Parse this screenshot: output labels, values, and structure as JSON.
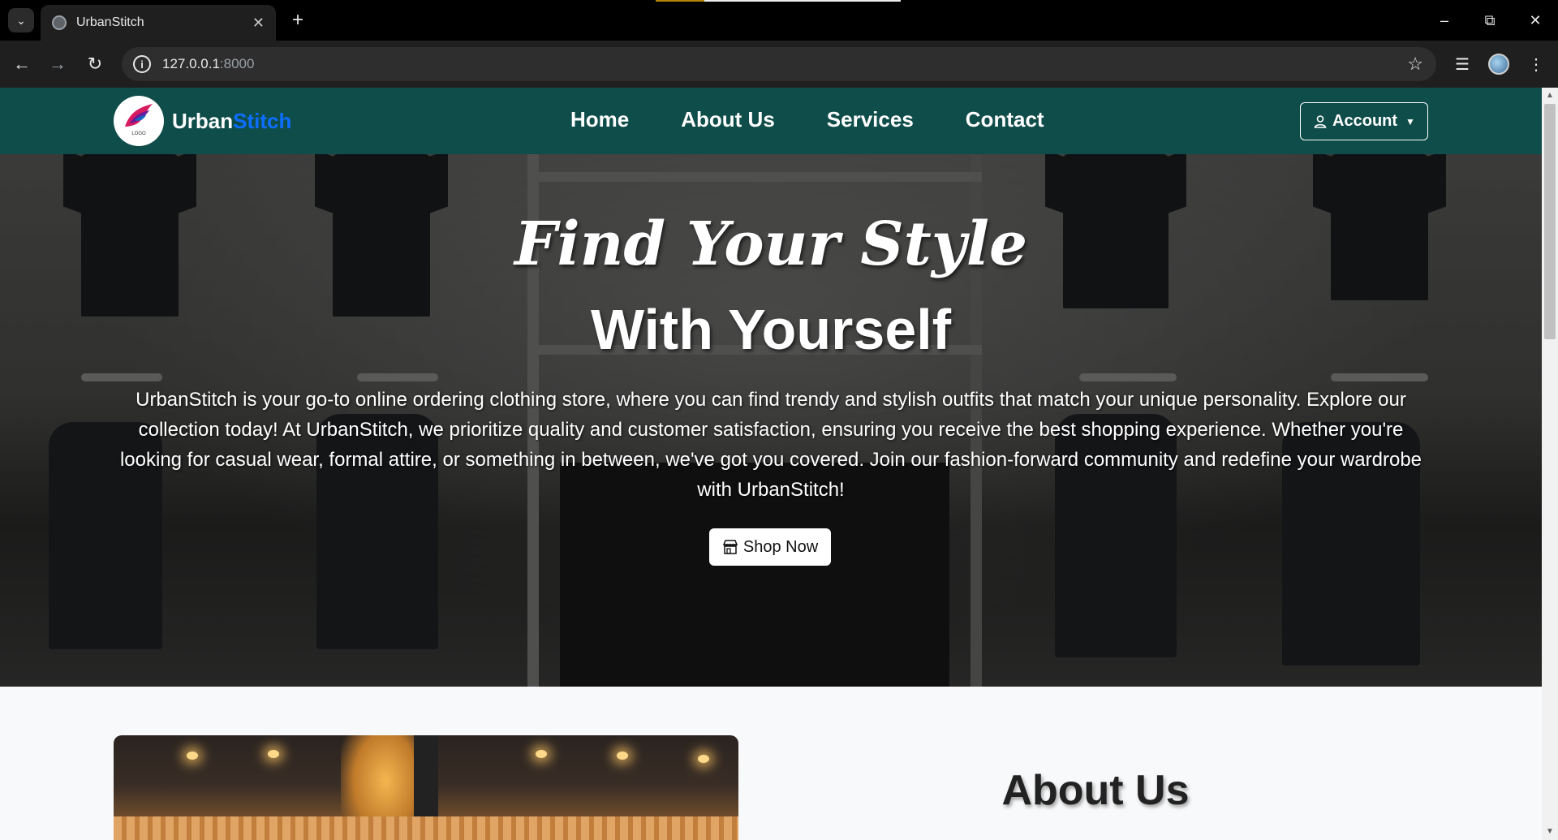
{
  "browser": {
    "tab_title": "UrbanStitch",
    "url_host": "127.0.0.1",
    "url_port": ":8000"
  },
  "navbar": {
    "brand_main": "Urban",
    "brand_accent": "Stitch",
    "logo_text": "LOGO",
    "menu": [
      "Home",
      "About Us",
      "Services",
      "Contact"
    ],
    "account_label": "Account"
  },
  "hero": {
    "title_line1": "Find Your Style",
    "title_line2": "With Yourself",
    "description": "UrbanStitch is your go-to online ordering clothing store, where you can find trendy and stylish outfits that match your unique personality. Explore our collection today! At UrbanStitch, we prioritize quality and customer satisfaction, ensuring you receive the best shopping experience. Whether you're looking for casual wear, formal attire, or something in between, we've got you covered. Join our fashion-forward community and redefine your wardrobe with UrbanStitch!",
    "cta_label": "Shop Now"
  },
  "about": {
    "title": "About Us"
  },
  "colors": {
    "navbar_bg": "#0f4d4a",
    "brand_accent": "#0d6efd",
    "page_bg": "#f8f9fa"
  },
  "icons": [
    "tab-list-icon",
    "globe-icon",
    "close-icon",
    "plus-icon",
    "minimize-icon",
    "restore-icon",
    "back-icon",
    "forward-icon",
    "reload-icon",
    "info-icon",
    "star-icon",
    "media-icon",
    "menu-icon",
    "user-icon",
    "caret-down-icon",
    "store-icon"
  ]
}
